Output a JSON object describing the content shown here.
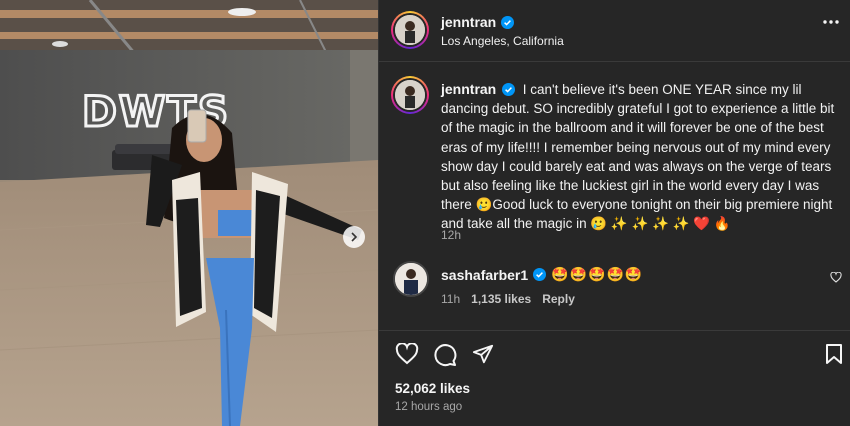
{
  "post": {
    "username": "jenntran",
    "location": "Los Angeles, California",
    "verified": true,
    "caption": "I can't believe it's been ONE YEAR since my lil dancing debut. SO incredibly grateful I got to experience a little bit of the magic in the ballroom and it will forever be one of the best eras of my life!!!! I remember being nervous out of my mind every show day I could barely eat and was always on the verge of tears but also feeling like the luckiest girl in the world every day I was there 🥲Good luck to everyone tonight on their big premiere night and take all the magic in 🥲 ✨ ✨ ✨ ✨ ❤️ 🔥",
    "caption_time": "12h",
    "likes": "52,062 likes",
    "time_ago": "12 hours ago",
    "media_sign": "DWTS"
  },
  "comment": {
    "username": "sashafarber1",
    "text": "🤩🤩🤩🤩🤩",
    "time": "11h",
    "likes": "1,135 likes",
    "reply_label": "Reply"
  },
  "icons": {
    "verified": "verified-badge-icon",
    "more": "more-options-icon",
    "next": "chevron-right-icon",
    "like": "heart-icon",
    "comment": "comment-icon",
    "share": "share-icon",
    "save": "bookmark-icon"
  },
  "colors": {
    "panel_bg": "#262626",
    "verified_blue": "#0095f6",
    "muted_text": "#a8a8a8"
  }
}
